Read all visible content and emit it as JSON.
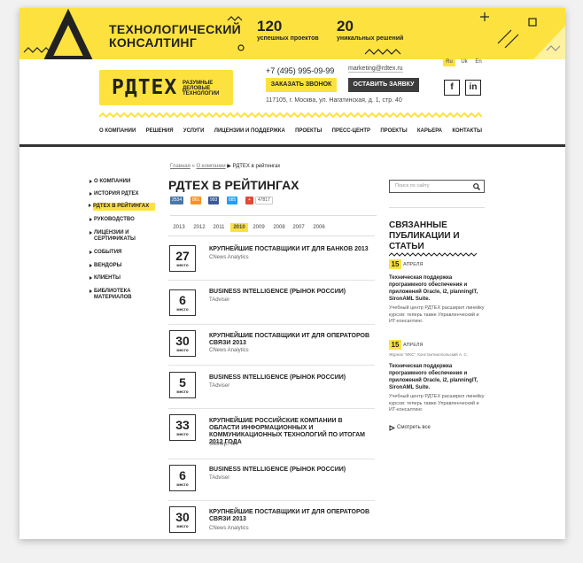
{
  "banner": {
    "title": "Технологический консалтинг",
    "stats": [
      {
        "num": "120",
        "label": "успешных проектов"
      },
      {
        "num": "20",
        "label": "уникальных решений"
      }
    ]
  },
  "header": {
    "logo": "РДТЕХ",
    "tagline": "Разумные деловые технологии",
    "phone": "+7 (495) 995-09-99",
    "email": "marketing@rdtex.ru",
    "call_btn": "Заказать звонок",
    "request_btn": "Оставить заявку",
    "address": "117105, г. Москва, ул. Нагатинская, д. 1, стр. 40",
    "langs": [
      "Ru",
      "Uk",
      "En"
    ],
    "active_lang": "Ru",
    "social": [
      "f",
      "in"
    ]
  },
  "nav": [
    "О компании",
    "Решения",
    "Услуги",
    "Лицензии и поддержка",
    "Проекты",
    "Пресс-центр",
    "Проекты",
    "Карьера",
    "Контакты"
  ],
  "sidebar": [
    {
      "label": "О компании"
    },
    {
      "label": "История РДТЕХ"
    },
    {
      "label": "РДТЕХ в рейтингах"
    },
    {
      "label": "Руководство"
    },
    {
      "label": "Лицензии и сертификаты"
    },
    {
      "label": "События"
    },
    {
      "label": "Вендоры"
    },
    {
      "label": "Клиенты"
    },
    {
      "label": "Библиотека материалов"
    }
  ],
  "breadcrumb": {
    "home": "Главная",
    "sep": "»",
    "company": "О компании",
    "current": "РДТЕХ в рейтингах"
  },
  "page_title": "РДТЕХ в рейтингах",
  "share": {
    "vk": "2534",
    "ok": "861",
    "fb": "993",
    "tw": "885",
    "plus": "47817"
  },
  "years": [
    "2013",
    "2012",
    "2011",
    "2010",
    "2009",
    "2008",
    "2007",
    "2006"
  ],
  "active_year": "2010",
  "rank_label": "место",
  "entries": [
    {
      "rank": "27",
      "title": "Крупнейшие поставщики ИТ для банков 2013",
      "source": "CNews Analytics"
    },
    {
      "rank": "6",
      "title": "Business Intelligence (рынок России)",
      "source": "TAdviser"
    },
    {
      "rank": "30",
      "title": "Крупнейшие поставщики ИТ для операторов связи 2013",
      "source": "CNews Analytics"
    },
    {
      "rank": "5",
      "title": "Business Intelligence (рынок России)",
      "source": "TAdviser"
    },
    {
      "rank": "33",
      "title": "Крупнейшие российские компании в области информационных и коммуникационных технологий по итогам 2012 года",
      "source": "Эксперт РА"
    },
    {
      "rank": "6",
      "title": "Business Intelligence (рынок России)",
      "source": "TAdviser"
    },
    {
      "rank": "30",
      "title": "Крупнейшие поставщики ИТ для операторов связи 2013",
      "source": "CNews Analytics"
    }
  ],
  "right": {
    "search_placeholder": "Поиск по сайту",
    "related_title": "Связанные публикации и статьи",
    "news": [
      {
        "day": "15",
        "month": "апреля",
        "meta": "",
        "title": "Техническая поддержка программного обеспечения и приложений Oracle, i2, planningIT, SironAML Suite.",
        "text": "Учебный центр РДТЕХ расширил линейку курсов: теперь также Управленческий и ИТ-консалтинг."
      },
      {
        "day": "15",
        "month": "апреля",
        "meta": "Журнал “ИКС”, Константинопольский А. С.",
        "title": "Техническая поддержка программного обеспечения и приложений Oracle, i2, planningIT, SironAML Suite.",
        "text": "Учебный центр РДТЕХ расширил линейку курсов: теперь также Управленческий и ИТ-консалтинг."
      }
    ],
    "see_all": "Смотреть все"
  }
}
